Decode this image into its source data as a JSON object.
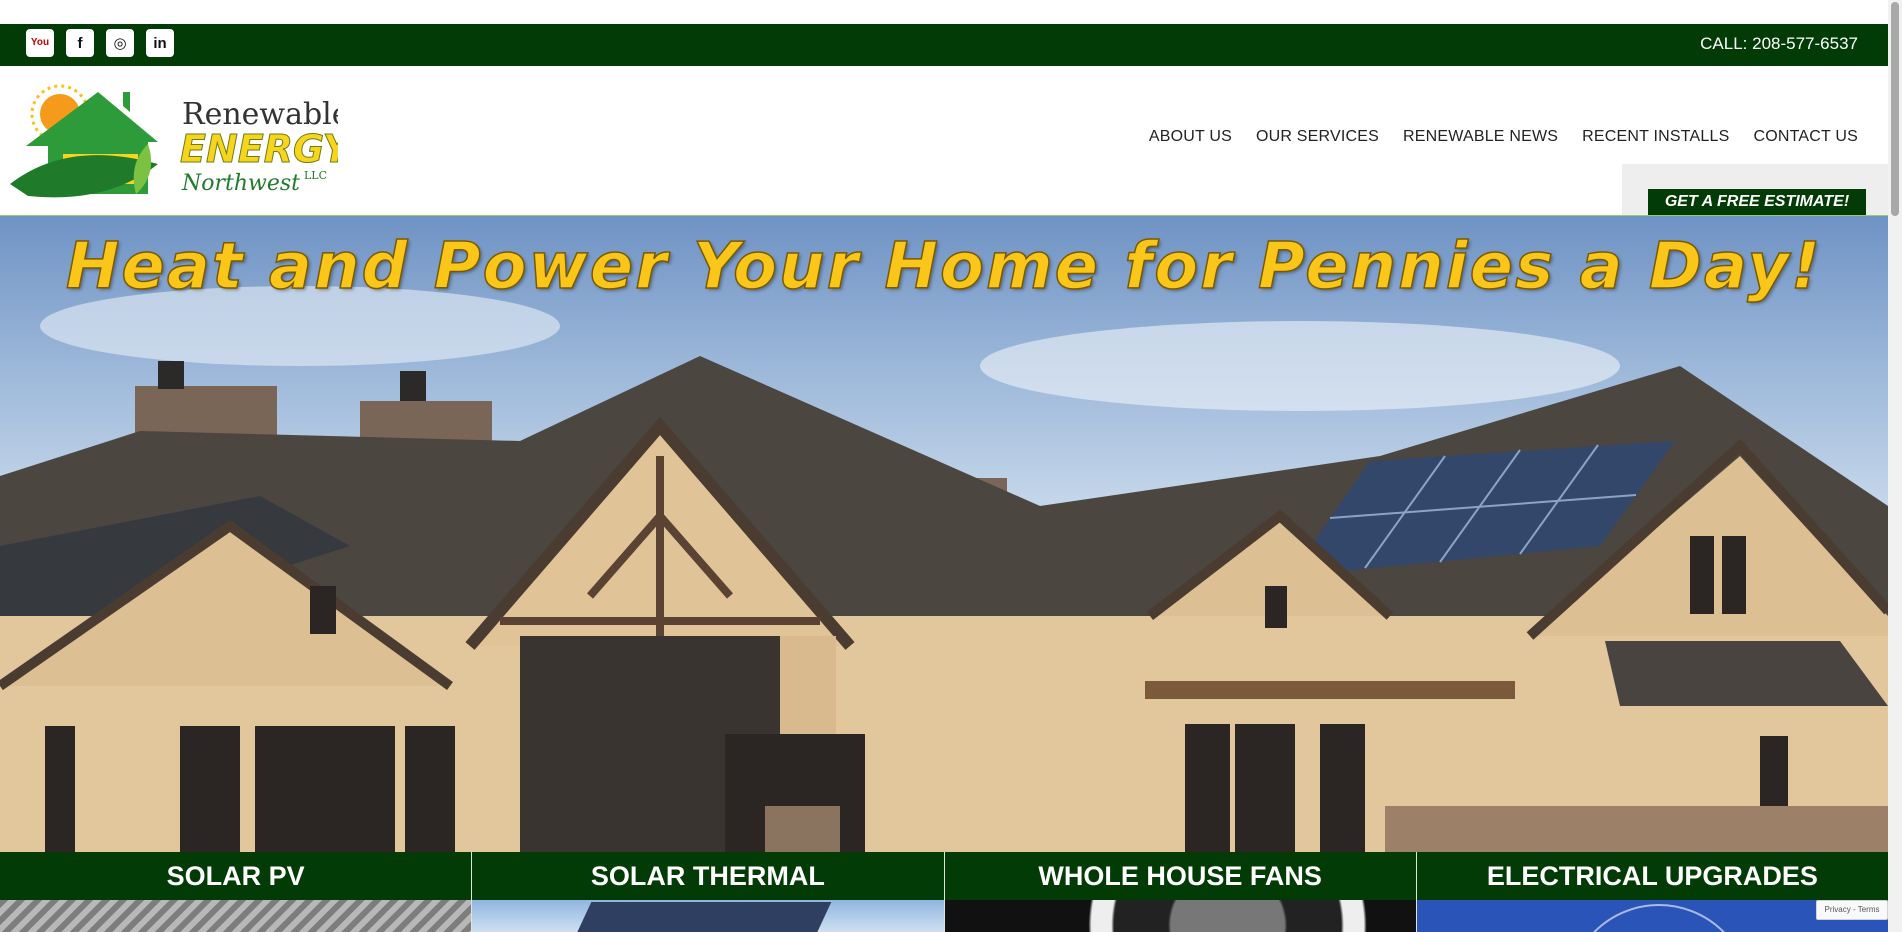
{
  "topbar": {
    "call_text": "CALL: 208-577-6537",
    "social": [
      {
        "name": "youtube-icon",
        "glyph": "You"
      },
      {
        "name": "facebook-icon",
        "glyph": "f"
      },
      {
        "name": "instagram-icon",
        "glyph": "◎"
      },
      {
        "name": "linkedin-icon",
        "glyph": "in"
      }
    ]
  },
  "logo": {
    "line1": "Renewable",
    "line2": "ENERGY",
    "line3": "Northwest",
    "suffix": "LLC"
  },
  "nav": {
    "items": [
      "ABOUT US",
      "OUR SERVICES",
      "RENEWABLE NEWS",
      "RECENT INSTALLS",
      "CONTACT US"
    ],
    "estimate_label": "GET A FREE ESTIMATE!"
  },
  "hero": {
    "headline": "Heat and Power Your Home for Pennies a Day!"
  },
  "services": [
    "SOLAR PV",
    "SOLAR THERMAL",
    "WHOLE HOUSE FANS",
    "ELECTRICAL UPGRADES"
  ],
  "recaptcha": {
    "text": "Privacy - Terms"
  },
  "colors": {
    "brand_dark_green": "#023b05",
    "headline_yellow": "#fac61a",
    "logo_green": "#2e9b3a",
    "logo_yellow": "#f7d51d"
  }
}
